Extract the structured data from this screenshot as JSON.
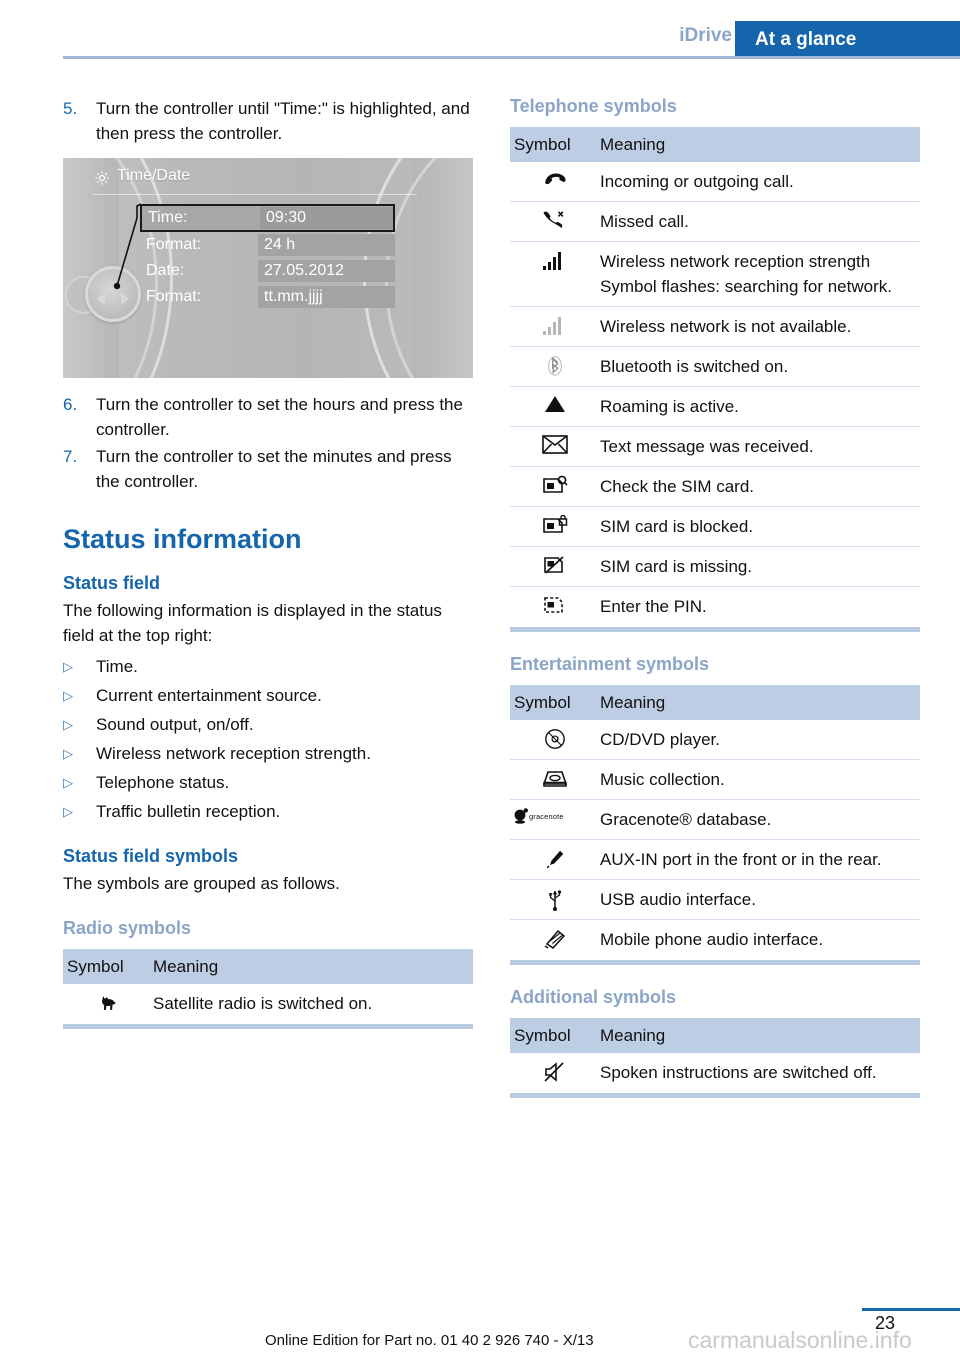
{
  "header": {
    "chapter": "iDrive",
    "section": "At a glance"
  },
  "left_column": {
    "steps": [
      {
        "num": "5.",
        "text": "Turn the controller until \"Time:\" is high&shy;lighted, and then press the controller."
      },
      {
        "num": "6.",
        "text": "Turn the controller to set the hours and press the controller."
      },
      {
        "num": "7.",
        "text": "Turn the controller to set the minutes and press the controller."
      }
    ],
    "idrive_screen": {
      "title": "Time/Date",
      "icon": "gear-icon",
      "rows": [
        {
          "label": "Time:",
          "value": "09:30",
          "selected": true
        },
        {
          "label": "Format:",
          "value": "24 h",
          "selected": false
        },
        {
          "label": "Date:",
          "value": "27.05.2012",
          "selected": false
        },
        {
          "label": "Format:",
          "value": "tt.mm.jjjj",
          "selected": false
        }
      ]
    },
    "status_information_heading": "Status information",
    "status_field_heading": "Status field",
    "status_field_intro": "The following information is displayed in the status field at the top right:",
    "status_field_items": [
      "Time.",
      "Current entertainment source.",
      "Sound output, on/off.",
      "Wireless network reception strength.",
      "Telephone status.",
      "Traffic bulletin reception."
    ],
    "status_field_symbols_heading": "Status field symbols",
    "status_field_symbols_intro": "The symbols are grouped as follows.",
    "radio_symbols": {
      "heading": "Radio symbols",
      "columns": {
        "symbol": "Symbol",
        "meaning": "Meaning"
      },
      "rows": [
        {
          "icon": "satellite-radio-dog-icon",
          "meaning": "Satellite radio is switched on."
        }
      ]
    }
  },
  "right_column": {
    "telephone_symbols": {
      "heading": "Telephone symbols",
      "columns": {
        "symbol": "Symbol",
        "meaning": "Meaning"
      },
      "rows": [
        {
          "icon": "phone-handset-icon",
          "meaning": "Incoming or outgoing call."
        },
        {
          "icon": "missed-call-icon",
          "meaning": "Missed call."
        },
        {
          "icon": "signal-bars-full-icon",
          "meaning": "Wireless network reception strength Symbol flashes: searching for network."
        },
        {
          "icon": "signal-bars-gray-icon",
          "meaning": "Wireless network is not available."
        },
        {
          "icon": "bluetooth-icon",
          "meaning": "Bluetooth is switched on."
        },
        {
          "icon": "roaming-triangle-icon",
          "meaning": "Roaming is active."
        },
        {
          "icon": "envelope-icon",
          "meaning": "Text message was received."
        },
        {
          "icon": "sim-check-icon",
          "meaning": "Check the SIM card."
        },
        {
          "icon": "sim-locked-icon",
          "meaning": "SIM card is blocked."
        },
        {
          "icon": "sim-missing-icon",
          "meaning": "SIM card is missing."
        },
        {
          "icon": "sim-pin-icon",
          "meaning": "Enter the PIN."
        }
      ]
    },
    "entertainment_symbols": {
      "heading": "Entertainment symbols",
      "columns": {
        "symbol": "Symbol",
        "meaning": "Meaning"
      },
      "rows": [
        {
          "icon": "cd-dvd-disc-icon",
          "meaning": "CD/DVD player."
        },
        {
          "icon": "music-collection-icon",
          "meaning": "Music collection."
        },
        {
          "icon": "gracenote-logo-icon",
          "meaning": "Gracenote® database."
        },
        {
          "icon": "aux-in-plug-icon",
          "meaning": "AUX-IN port in the front or in the rear."
        },
        {
          "icon": "usb-icon",
          "meaning": "USB audio interface."
        },
        {
          "icon": "mobile-phone-audio-icon",
          "meaning": "Mobile phone audio interface."
        }
      ]
    },
    "additional_symbols": {
      "heading": "Additional symbols",
      "columns": {
        "symbol": "Symbol",
        "meaning": "Meaning"
      },
      "rows": [
        {
          "icon": "speaker-muted-icon",
          "meaning": "Spoken instructions are switched off."
        }
      ]
    }
  },
  "footer": {
    "page_number": "23",
    "edition": "Online Edition for Part no. 01 40 2 926 740 - X/13",
    "watermark": "carmanualsonline.info"
  },
  "colors": {
    "accent_blue": "#1565ad",
    "muted_blue": "#8aa5c8",
    "table_header_bg": "#bdcee4",
    "table_bottom_border": "#b9cae0"
  }
}
